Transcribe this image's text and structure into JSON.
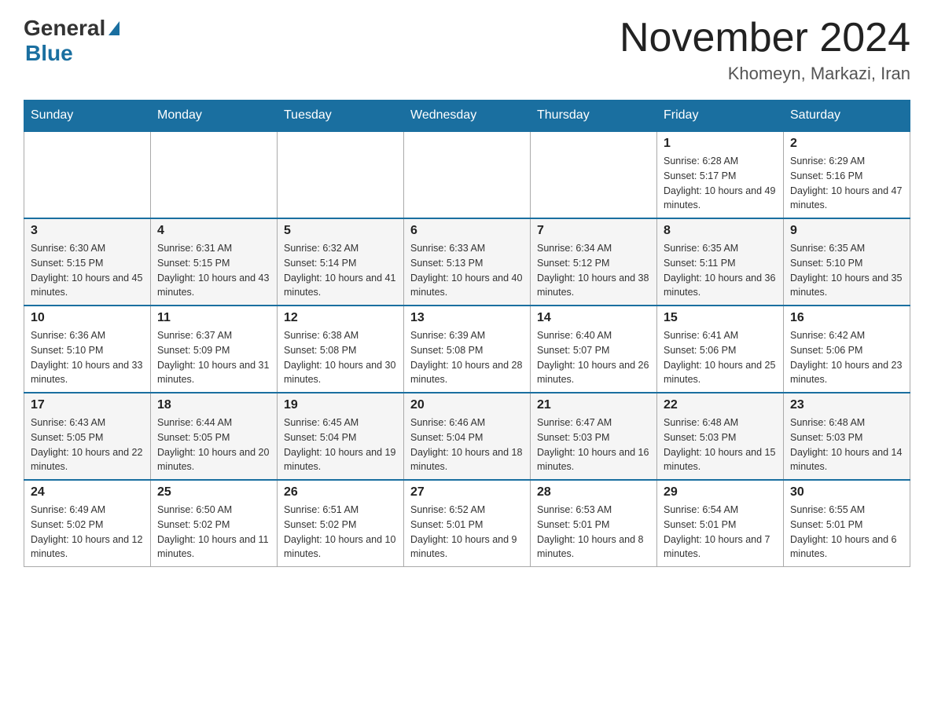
{
  "header": {
    "logo_general": "General",
    "logo_blue": "Blue",
    "month_title": "November 2024",
    "location": "Khomeyn, Markazi, Iran"
  },
  "weekdays": [
    "Sunday",
    "Monday",
    "Tuesday",
    "Wednesday",
    "Thursday",
    "Friday",
    "Saturday"
  ],
  "weeks": [
    [
      {
        "day": "",
        "info": ""
      },
      {
        "day": "",
        "info": ""
      },
      {
        "day": "",
        "info": ""
      },
      {
        "day": "",
        "info": ""
      },
      {
        "day": "",
        "info": ""
      },
      {
        "day": "1",
        "info": "Sunrise: 6:28 AM\nSunset: 5:17 PM\nDaylight: 10 hours and 49 minutes."
      },
      {
        "day": "2",
        "info": "Sunrise: 6:29 AM\nSunset: 5:16 PM\nDaylight: 10 hours and 47 minutes."
      }
    ],
    [
      {
        "day": "3",
        "info": "Sunrise: 6:30 AM\nSunset: 5:15 PM\nDaylight: 10 hours and 45 minutes."
      },
      {
        "day": "4",
        "info": "Sunrise: 6:31 AM\nSunset: 5:15 PM\nDaylight: 10 hours and 43 minutes."
      },
      {
        "day": "5",
        "info": "Sunrise: 6:32 AM\nSunset: 5:14 PM\nDaylight: 10 hours and 41 minutes."
      },
      {
        "day": "6",
        "info": "Sunrise: 6:33 AM\nSunset: 5:13 PM\nDaylight: 10 hours and 40 minutes."
      },
      {
        "day": "7",
        "info": "Sunrise: 6:34 AM\nSunset: 5:12 PM\nDaylight: 10 hours and 38 minutes."
      },
      {
        "day": "8",
        "info": "Sunrise: 6:35 AM\nSunset: 5:11 PM\nDaylight: 10 hours and 36 minutes."
      },
      {
        "day": "9",
        "info": "Sunrise: 6:35 AM\nSunset: 5:10 PM\nDaylight: 10 hours and 35 minutes."
      }
    ],
    [
      {
        "day": "10",
        "info": "Sunrise: 6:36 AM\nSunset: 5:10 PM\nDaylight: 10 hours and 33 minutes."
      },
      {
        "day": "11",
        "info": "Sunrise: 6:37 AM\nSunset: 5:09 PM\nDaylight: 10 hours and 31 minutes."
      },
      {
        "day": "12",
        "info": "Sunrise: 6:38 AM\nSunset: 5:08 PM\nDaylight: 10 hours and 30 minutes."
      },
      {
        "day": "13",
        "info": "Sunrise: 6:39 AM\nSunset: 5:08 PM\nDaylight: 10 hours and 28 minutes."
      },
      {
        "day": "14",
        "info": "Sunrise: 6:40 AM\nSunset: 5:07 PM\nDaylight: 10 hours and 26 minutes."
      },
      {
        "day": "15",
        "info": "Sunrise: 6:41 AM\nSunset: 5:06 PM\nDaylight: 10 hours and 25 minutes."
      },
      {
        "day": "16",
        "info": "Sunrise: 6:42 AM\nSunset: 5:06 PM\nDaylight: 10 hours and 23 minutes."
      }
    ],
    [
      {
        "day": "17",
        "info": "Sunrise: 6:43 AM\nSunset: 5:05 PM\nDaylight: 10 hours and 22 minutes."
      },
      {
        "day": "18",
        "info": "Sunrise: 6:44 AM\nSunset: 5:05 PM\nDaylight: 10 hours and 20 minutes."
      },
      {
        "day": "19",
        "info": "Sunrise: 6:45 AM\nSunset: 5:04 PM\nDaylight: 10 hours and 19 minutes."
      },
      {
        "day": "20",
        "info": "Sunrise: 6:46 AM\nSunset: 5:04 PM\nDaylight: 10 hours and 18 minutes."
      },
      {
        "day": "21",
        "info": "Sunrise: 6:47 AM\nSunset: 5:03 PM\nDaylight: 10 hours and 16 minutes."
      },
      {
        "day": "22",
        "info": "Sunrise: 6:48 AM\nSunset: 5:03 PM\nDaylight: 10 hours and 15 minutes."
      },
      {
        "day": "23",
        "info": "Sunrise: 6:48 AM\nSunset: 5:03 PM\nDaylight: 10 hours and 14 minutes."
      }
    ],
    [
      {
        "day": "24",
        "info": "Sunrise: 6:49 AM\nSunset: 5:02 PM\nDaylight: 10 hours and 12 minutes."
      },
      {
        "day": "25",
        "info": "Sunrise: 6:50 AM\nSunset: 5:02 PM\nDaylight: 10 hours and 11 minutes."
      },
      {
        "day": "26",
        "info": "Sunrise: 6:51 AM\nSunset: 5:02 PM\nDaylight: 10 hours and 10 minutes."
      },
      {
        "day": "27",
        "info": "Sunrise: 6:52 AM\nSunset: 5:01 PM\nDaylight: 10 hours and 9 minutes."
      },
      {
        "day": "28",
        "info": "Sunrise: 6:53 AM\nSunset: 5:01 PM\nDaylight: 10 hours and 8 minutes."
      },
      {
        "day": "29",
        "info": "Sunrise: 6:54 AM\nSunset: 5:01 PM\nDaylight: 10 hours and 7 minutes."
      },
      {
        "day": "30",
        "info": "Sunrise: 6:55 AM\nSunset: 5:01 PM\nDaylight: 10 hours and 6 minutes."
      }
    ]
  ]
}
